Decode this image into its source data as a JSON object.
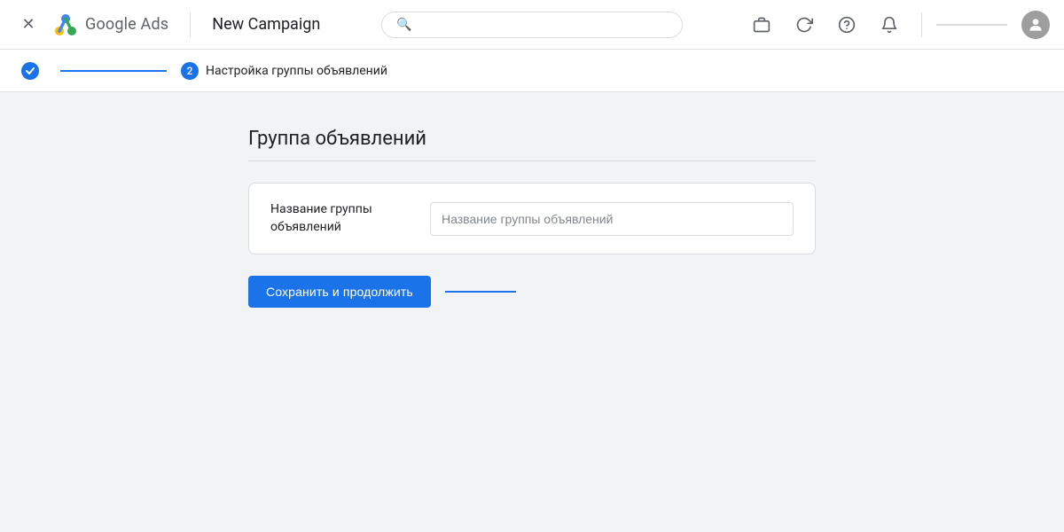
{
  "header": {
    "close_icon": "✕",
    "app_name": "Google Ads",
    "campaign_title": "New Campaign",
    "search_placeholder": "",
    "icons": {
      "briefcase": "💼",
      "refresh": "↻",
      "help": "?",
      "bell": "🔔"
    },
    "avatar_letter": ""
  },
  "progress": {
    "step1_done": true,
    "step1_check": "✓",
    "step2_number": "2",
    "step2_label": "Настройка группы объявлений"
  },
  "main": {
    "section_title": "Группа объявлений",
    "form": {
      "label": "Название группы объявлений",
      "placeholder": "Название группы объявлений"
    },
    "save_button": "Сохранить и продолжить"
  }
}
